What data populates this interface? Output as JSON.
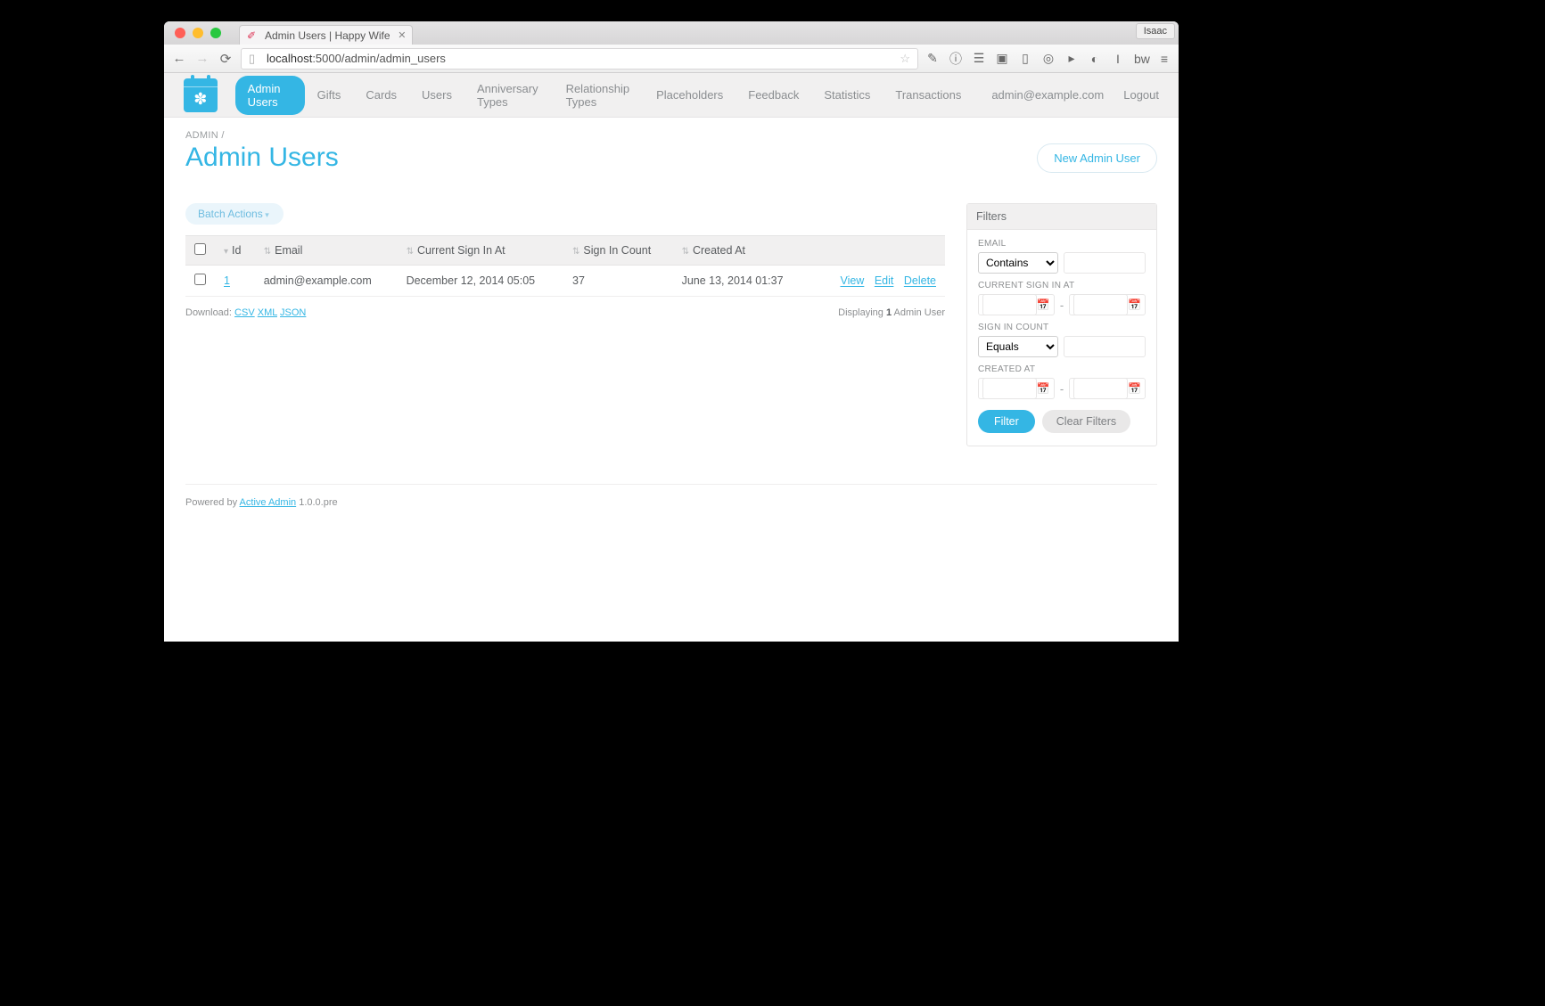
{
  "browser": {
    "profile_name": "Isaac",
    "tab_title": "Admin Users | Happy Wife",
    "url_host": "localhost",
    "url_port_path": ":5000/admin/admin_users"
  },
  "nav": {
    "items": [
      "Admin Users",
      "Gifts",
      "Cards",
      "Users",
      "Anniversary Types",
      "Relationship Types",
      "Placeholders",
      "Feedback",
      "Statistics",
      "Transactions"
    ],
    "active": "Admin Users",
    "user_email": "admin@example.com",
    "logout": "Logout"
  },
  "breadcrumb": {
    "root": "ADMIN",
    "sep": "/"
  },
  "page": {
    "title": "Admin Users",
    "new_button": "New Admin User",
    "batch_actions": "Batch Actions"
  },
  "table": {
    "columns": [
      "Id",
      "Email",
      "Current Sign In At",
      "Sign In Count",
      "Created At"
    ],
    "rows": [
      {
        "id": "1",
        "email": "admin@example.com",
        "current_sign_in_at": "December 12, 2014 05:05",
        "sign_in_count": "37",
        "created_at": "June 13, 2014 01:37"
      }
    ],
    "actions": {
      "view": "View",
      "edit": "Edit",
      "delete": "Delete"
    }
  },
  "download": {
    "label": "Download:",
    "formats": [
      "CSV",
      "XML",
      "JSON"
    ]
  },
  "pagination": {
    "prefix": "Displaying ",
    "count": "1",
    "suffix": " Admin User"
  },
  "filters": {
    "heading": "Filters",
    "email": {
      "label": "EMAIL",
      "op": "Contains"
    },
    "current_sign_in_at": {
      "label": "CURRENT SIGN IN AT"
    },
    "sign_in_count": {
      "label": "SIGN IN COUNT",
      "op": "Equals"
    },
    "created_at": {
      "label": "CREATED AT"
    },
    "submit": "Filter",
    "clear": "Clear Filters"
  },
  "footer": {
    "prefix": "Powered by ",
    "link": "Active Admin",
    "suffix": " 1.0.0.pre"
  }
}
